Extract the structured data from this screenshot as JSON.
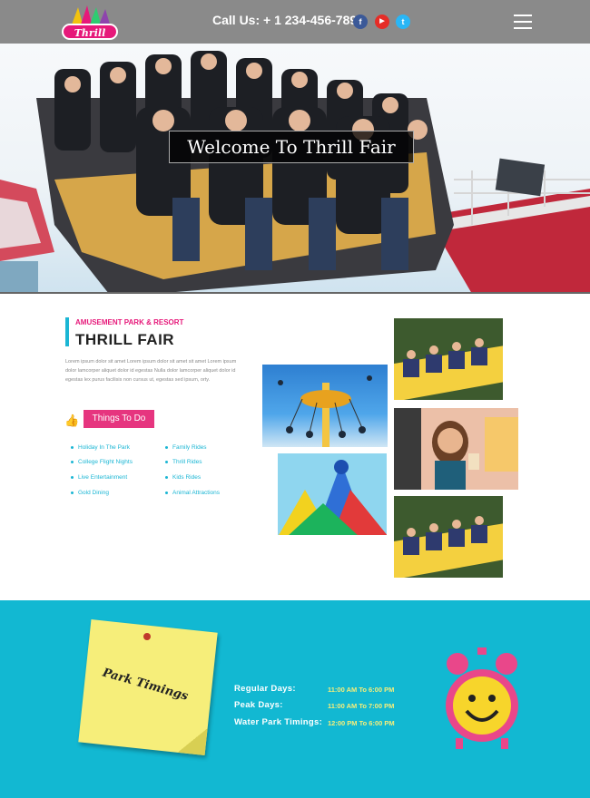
{
  "header": {
    "logo_text": "Thrill Fair",
    "call_text": "Call Us: + 1 234-456-789",
    "social": [
      {
        "name": "facebook",
        "glyph": "f",
        "color": "#3b5998"
      },
      {
        "name": "youtube",
        "glyph": "▶",
        "color": "#e52d27"
      },
      {
        "name": "twitter",
        "glyph": "t",
        "color": "#29b6f6"
      }
    ]
  },
  "hero": {
    "title": "Welcome To Thrill Fair"
  },
  "about": {
    "subtitle": "AMUSEMENT PARK & RESORT",
    "title": "THRILL FAIR",
    "body": "Lorem ipsum dolor sit amet Lorem ipsum dolor sit amet sit amet Lorem ipsum dolor lamcorper aliquet dolor id egestas Nulla dolor lamcorper aliquet dolor id egestas lex purus facilisis non cursus ut, egestas sed ipsum, orty.",
    "button_label": "Things To Do",
    "list_left": [
      "Holiday In The Park",
      "College Flight Nights",
      "Live Entertainment",
      "Gold Dining"
    ],
    "list_right": [
      "Family Rides",
      "Thrill Rides",
      "Kids Rides",
      "Animal Attractions"
    ]
  },
  "timings": {
    "note_text": "Park Timings",
    "rows": [
      {
        "label": "Regular Days:",
        "value": "11:00 AM To 6:00 PM"
      },
      {
        "label": "Peak Days:",
        "value": "11:00 AM To 7:00 PM"
      },
      {
        "label": "Water Park Timings:",
        "value": "12:00 PM To 6:00 PM"
      }
    ]
  }
}
